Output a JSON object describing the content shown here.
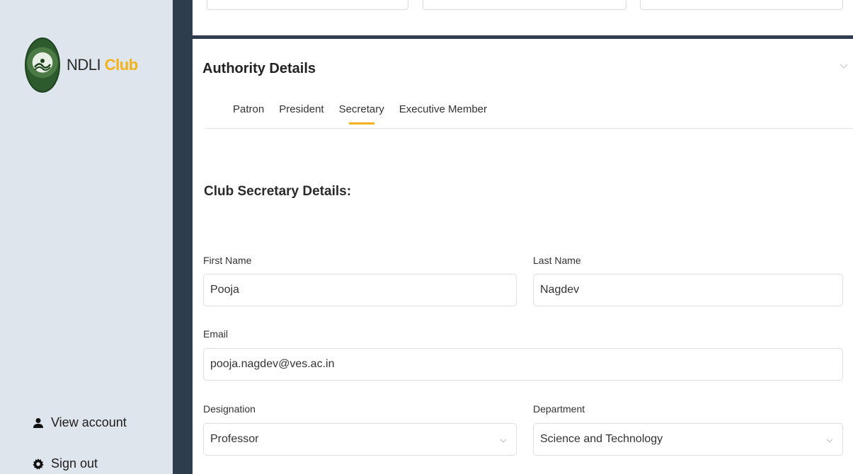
{
  "sidebar": {
    "logo": {
      "name": "NDLI",
      "accent": "Club"
    },
    "links": {
      "view_account": "View account",
      "sign_out": "Sign out"
    }
  },
  "section": {
    "title": "Authority Details",
    "tabs": [
      "Patron",
      "President",
      "Secretary",
      "Executive Member"
    ],
    "active_tab": "Secretary",
    "subtitle": "Club Secretary Details:"
  },
  "form": {
    "first_name": {
      "label": "First Name",
      "value": "Pooja"
    },
    "last_name": {
      "label": "Last Name",
      "value": "Nagdev"
    },
    "email": {
      "label": "Email",
      "value": "pooja.nagdev@ves.ac.in"
    },
    "designation": {
      "label": "Designation",
      "value": "Professor"
    },
    "department": {
      "label": "Department",
      "value": "Science and Technology"
    }
  },
  "colors": {
    "accent": "#f2b21a",
    "sidebar_bg": "#dfe5ec",
    "dark_strip": "#2d3d4e"
  },
  "icons": {
    "logo": "ndli-emblem-icon",
    "view_account": "user-icon",
    "sign_out": "gear-icon",
    "collapse": "chevron-down-icon",
    "select": "chevron-down-icon"
  }
}
